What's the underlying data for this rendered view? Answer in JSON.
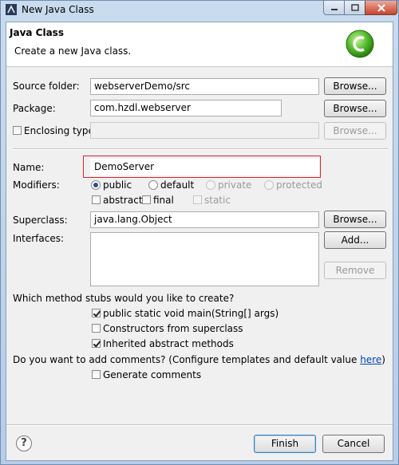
{
  "window": {
    "title": "New Java Class"
  },
  "header": {
    "title": "Java Class",
    "description": "Create a new Java class."
  },
  "source_folder": {
    "label": "Source folder:",
    "value": "webserverDemo/src",
    "browse": "Browse..."
  },
  "package": {
    "label": "Package:",
    "value": "com.hzdl.webserver",
    "browse": "Browse..."
  },
  "enclosing": {
    "label": "Enclosing type:",
    "checked": false,
    "value": "",
    "browse": "Browse..."
  },
  "name": {
    "label": "Name:",
    "value": "DemoServer"
  },
  "modifiers": {
    "label": "Modifiers:",
    "access": [
      {
        "label": "public",
        "selected": true,
        "enabled": true
      },
      {
        "label": "default",
        "selected": false,
        "enabled": true
      },
      {
        "label": "private",
        "selected": false,
        "enabled": false
      },
      {
        "label": "protected",
        "selected": false,
        "enabled": false
      }
    ],
    "other": [
      {
        "label": "abstract",
        "checked": false,
        "enabled": true
      },
      {
        "label": "final",
        "checked": false,
        "enabled": true
      },
      {
        "label": "static",
        "checked": false,
        "enabled": false
      }
    ]
  },
  "superclass": {
    "label": "Superclass:",
    "value": "java.lang.Object",
    "browse": "Browse..."
  },
  "interfaces": {
    "label": "Interfaces:",
    "add": "Add...",
    "remove": "Remove"
  },
  "stubs": {
    "question": "Which method stubs would you like to create?",
    "options": [
      {
        "label": "public static void main(String[] args)",
        "checked": true
      },
      {
        "label": "Constructors from superclass",
        "checked": false
      },
      {
        "label": "Inherited abstract methods",
        "checked": true
      }
    ]
  },
  "comments": {
    "question": "Do you want to add comments? (Configure templates and default value ",
    "link": "here",
    "question_end": ")",
    "option": {
      "label": "Generate comments",
      "checked": false
    }
  },
  "footer": {
    "help": "?",
    "finish": "Finish",
    "cancel": "Cancel"
  }
}
